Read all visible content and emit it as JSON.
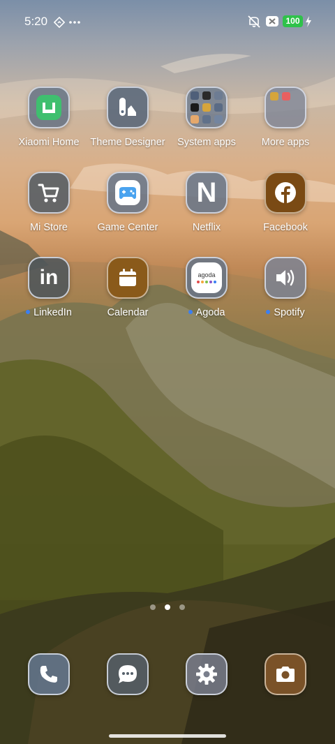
{
  "status_bar": {
    "time": "5:20",
    "battery": "100",
    "icons": [
      "nav-diamond-icon",
      "more-dots-icon",
      "mute-icon",
      "no-sim-icon",
      "battery-icon",
      "charging-icon"
    ]
  },
  "apps": [
    {
      "label": "Xiaomi Home",
      "icon": "xiaomi-home-icon",
      "dot": false
    },
    {
      "label": "Theme Designer",
      "icon": "theme-designer-icon",
      "dot": false
    },
    {
      "label": "System apps",
      "icon": "folder-icon",
      "dot": false
    },
    {
      "label": "More apps",
      "icon": "folder-icon",
      "dot": false
    },
    {
      "label": "Mi Store",
      "icon": "cart-icon",
      "dot": false
    },
    {
      "label": "Game Center",
      "icon": "gamepad-icon",
      "dot": false
    },
    {
      "label": "Netflix",
      "icon": "netflix-n-icon",
      "dot": false
    },
    {
      "label": "Facebook",
      "icon": "facebook-f-icon",
      "dot": false
    },
    {
      "label": "LinkedIn",
      "icon": "linkedin-in-icon",
      "dot": true
    },
    {
      "label": "Calendar",
      "icon": "calendar-icon",
      "dot": false
    },
    {
      "label": "Agoda",
      "icon": "agoda-icon",
      "dot": true
    },
    {
      "label": "Spotify",
      "icon": "speaker-icon",
      "dot": true
    }
  ],
  "agoda_logo_text": "agoda",
  "netflix_letter": "N",
  "linkedin_text": "in",
  "page_indicator": {
    "pages": 3,
    "active": 2
  },
  "dock": [
    {
      "name": "phone",
      "icon": "phone-icon"
    },
    {
      "name": "messages",
      "icon": "message-icon"
    },
    {
      "name": "settings",
      "icon": "gear-icon"
    },
    {
      "name": "camera",
      "icon": "camera-icon"
    }
  ],
  "colors": {
    "notification_dot": "#3a7ff3",
    "battery_green": "#2fc24a",
    "xiaomi_green": "#3fbf6f",
    "facebook_brown": "#7a4a14",
    "calendar_brown": "#8a5a1a",
    "camera_brown": "#7a5228"
  }
}
